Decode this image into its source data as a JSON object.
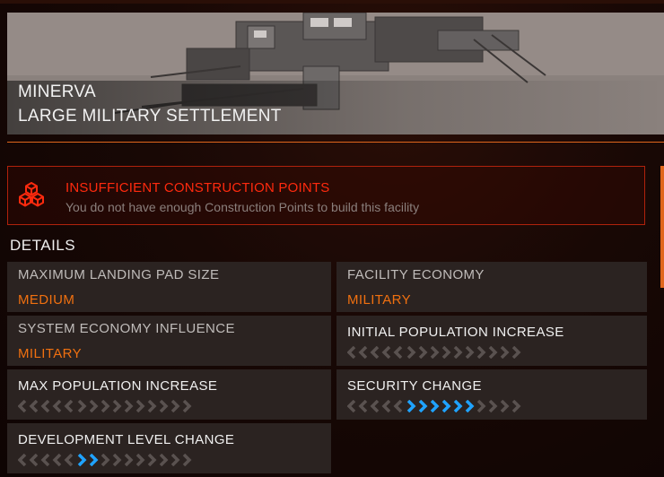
{
  "facility": {
    "name": "MINERVA",
    "type": "LARGE MILITARY SETTLEMENT"
  },
  "warning": {
    "icon": "construction-cubes-icon",
    "title": "INSUFFICIENT CONSTRUCTION POINTS",
    "message": "You do not have enough Construction Points to build this facility"
  },
  "details": {
    "heading": "DETAILS",
    "items": [
      {
        "label": "MAXIMUM LANDING PAD SIZE",
        "value": "MEDIUM"
      },
      {
        "label": "FACILITY ECONOMY",
        "value": "MILITARY"
      },
      {
        "label": "SYSTEM ECONOMY INFLUENCE",
        "value": "MILITARY"
      },
      {
        "label": "INITIAL POPULATION INCREASE",
        "gauge": {
          "negative_active": 0,
          "positive_active": 0
        }
      },
      {
        "label": "MAX POPULATION INCREASE",
        "gauge": {
          "negative_active": 0,
          "positive_active": 0
        }
      },
      {
        "label": "SECURITY CHANGE",
        "gauge": {
          "negative_active": 0,
          "positive_active": 6
        }
      },
      {
        "label": "DEVELOPMENT LEVEL CHANGE",
        "gauge": {
          "negative_active": 0,
          "positive_active": 2
        }
      }
    ]
  },
  "colors": {
    "accent": "#e0661c",
    "warning": "#ff2a0e",
    "value": "#f07010",
    "gauge_active": "#1fa3ff",
    "gauge_inactive": "#5a5250"
  }
}
